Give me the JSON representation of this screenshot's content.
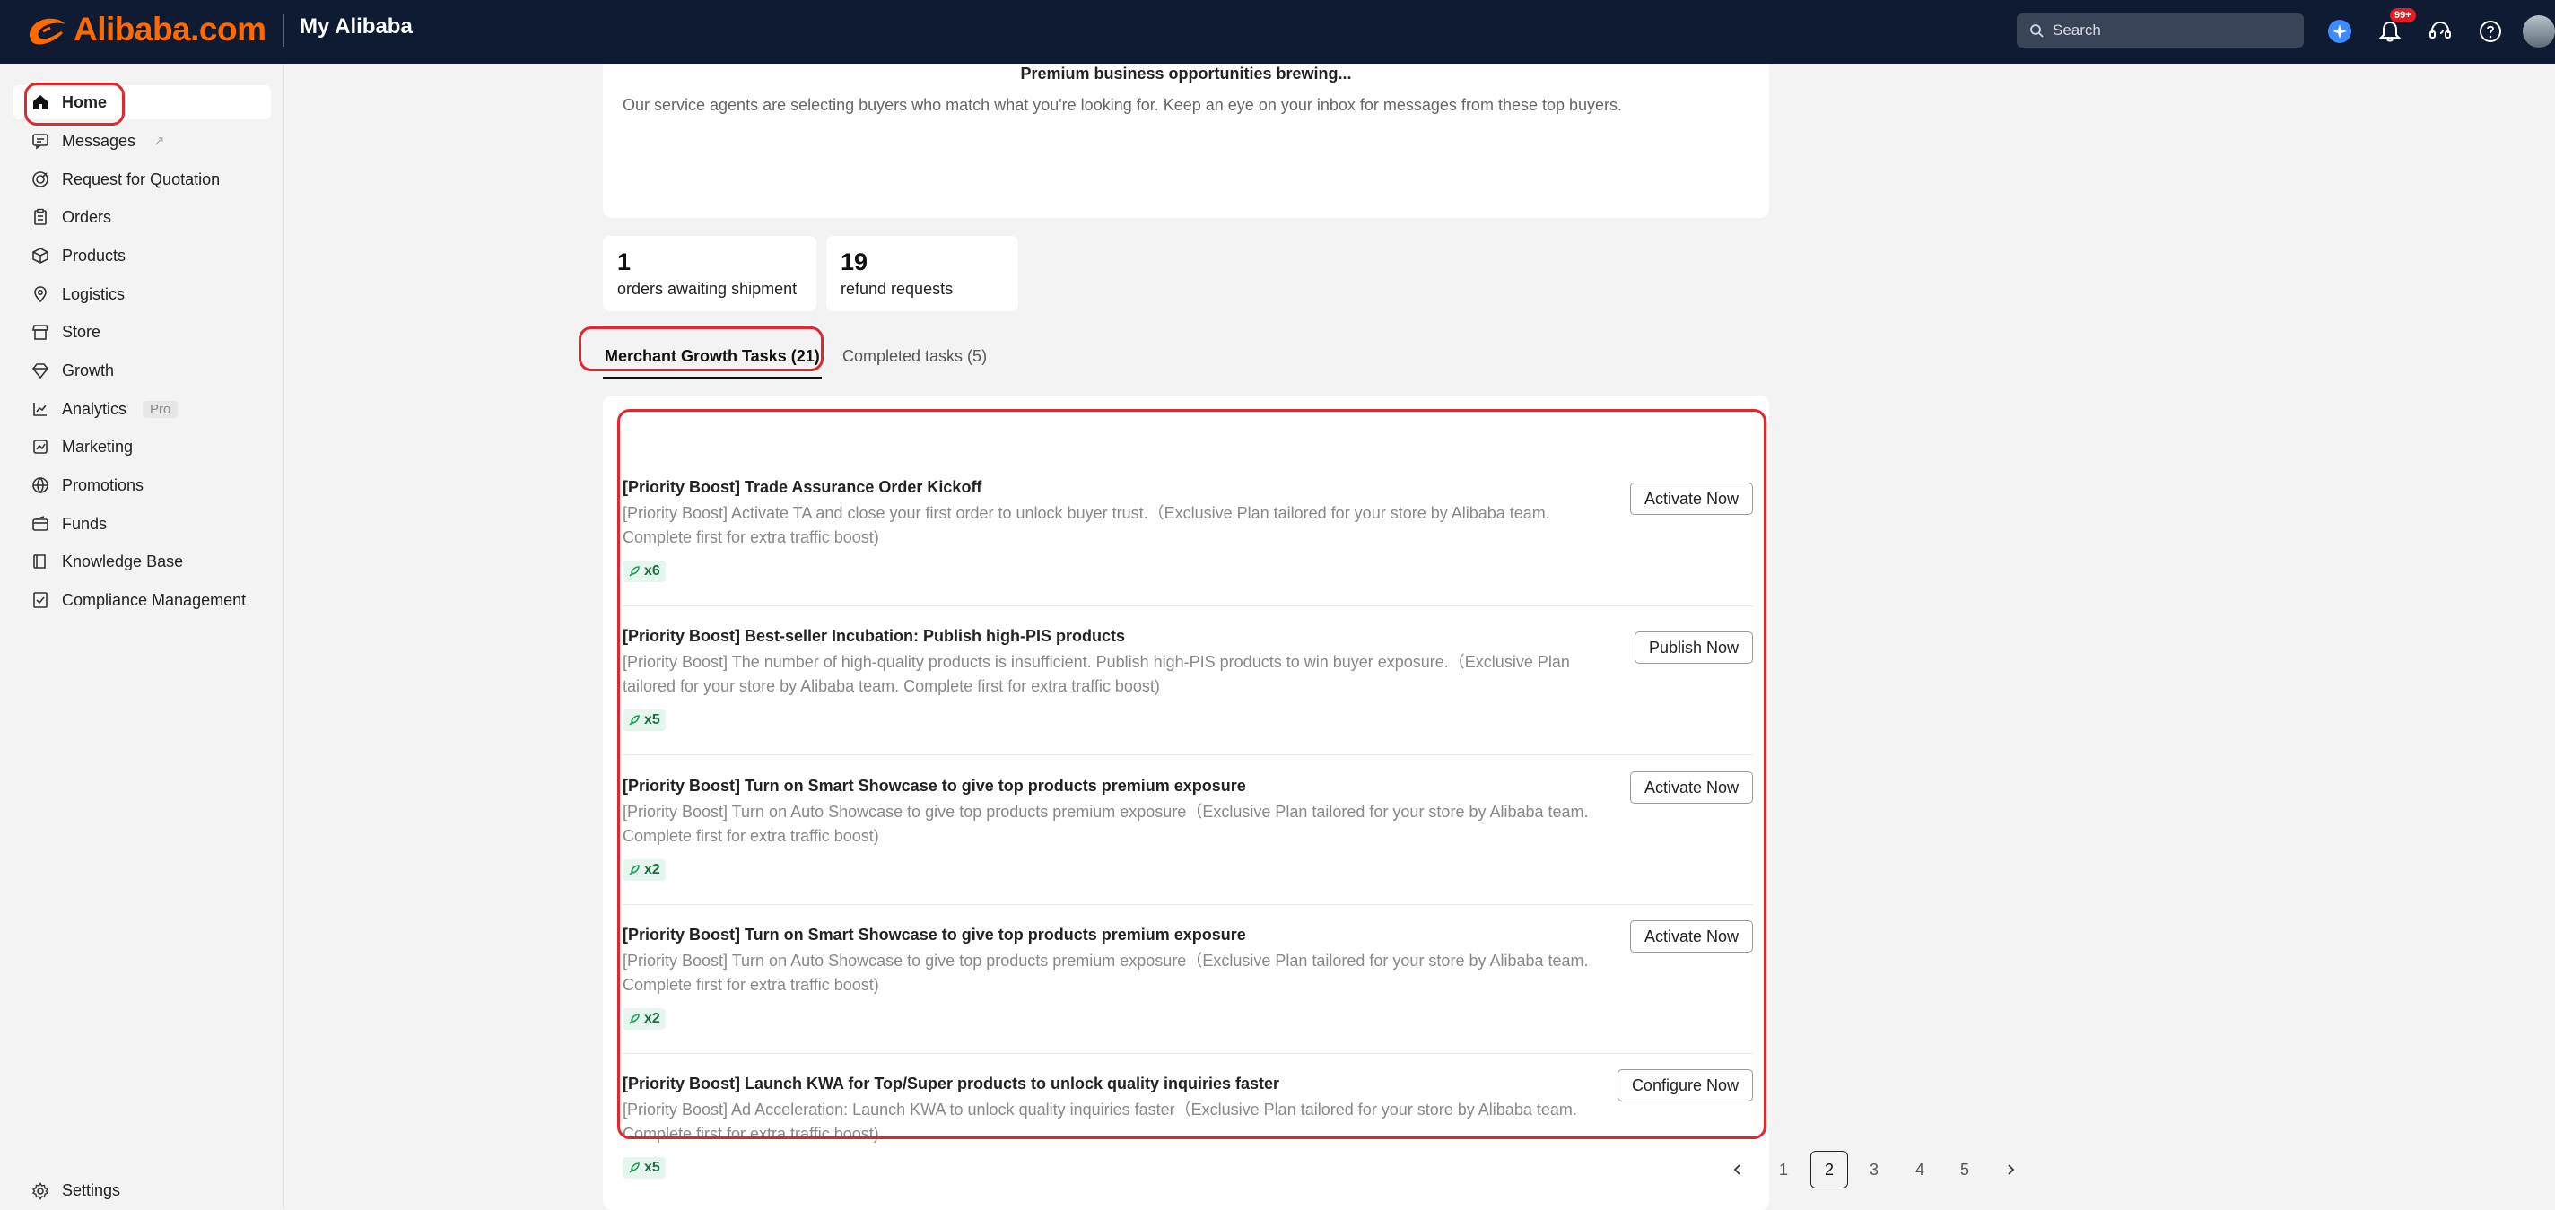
{
  "header": {
    "brand": "Alibaba.com",
    "title": "My Alibaba",
    "search_placeholder": "Search",
    "notification_badge": "99+",
    "brand_color": "#ff6a00"
  },
  "sidebar": {
    "items": [
      {
        "label": "Home",
        "icon": "home-icon",
        "active": true
      },
      {
        "label": "Messages",
        "icon": "message-icon"
      },
      {
        "label": "Request for Quotation",
        "icon": "quotation-icon"
      },
      {
        "label": "Orders",
        "icon": "orders-icon"
      },
      {
        "label": "Products",
        "icon": "box-icon"
      },
      {
        "label": "Logistics",
        "icon": "logistics-icon"
      },
      {
        "label": "Store",
        "icon": "store-icon"
      },
      {
        "label": "Growth",
        "icon": "growth-icon"
      },
      {
        "label": "Analytics",
        "icon": "analytics-icon",
        "tag": "Pro"
      },
      {
        "label": "Marketing",
        "icon": "marketing-icon"
      },
      {
        "label": "Promotions",
        "icon": "promotions-icon"
      },
      {
        "label": "Funds",
        "icon": "funds-icon"
      },
      {
        "label": "Knowledge Base",
        "icon": "book-icon"
      },
      {
        "label": "Compliance Management",
        "icon": "compliance-icon"
      }
    ],
    "settings_label": "Settings"
  },
  "banner": {
    "headline": "Premium business opportunities brewing...",
    "description": "Our service agents are selecting buyers who match what you're looking for. Keep an eye on your inbox for messages from these top buyers."
  },
  "stats": [
    {
      "value": "1",
      "label": "orders awaiting shipment"
    },
    {
      "value": "19",
      "label": "refund requests"
    }
  ],
  "tabs": [
    {
      "label": "Merchant Growth Tasks (21)",
      "active": true
    },
    {
      "label": "Completed tasks (5)",
      "active": false
    }
  ],
  "tasks": [
    {
      "title": "[Priority Boost] Trade Assurance Order Kickoff",
      "description": "[Priority Boost] Activate TA and close your first order to unlock buyer trust.（Exclusive Plan tailored for your store by Alibaba team. Complete first for extra traffic boost)",
      "multiplier": "x6",
      "action": "Activate Now"
    },
    {
      "title": "[Priority Boost] Best-seller Incubation: Publish high-PIS products",
      "description": "[Priority Boost] The number of high-quality products is insufficient. Publish high-PIS products to win buyer exposure.（Exclusive Plan tailored for your store by Alibaba team. Complete first for extra traffic boost)",
      "multiplier": "x5",
      "action": "Publish Now"
    },
    {
      "title": "[Priority Boost] Turn on Smart Showcase to give top products premium exposure",
      "description": "[Priority Boost] Turn on Auto Showcase to give top products premium exposure（Exclusive Plan tailored for your store by Alibaba team. Complete first for extra traffic boost)",
      "multiplier": "x2",
      "action": "Activate Now"
    },
    {
      "title": "[Priority Boost] Turn on Smart Showcase to give top products premium exposure",
      "description": "[Priority Boost] Turn on Auto Showcase to give top products premium exposure（Exclusive Plan tailored for your store by Alibaba team. Complete first for extra traffic boost)",
      "multiplier": "x2",
      "action": "Activate Now"
    },
    {
      "title": "[Priority Boost] Launch KWA for Top/Super products to unlock quality inquiries faster",
      "description": "[Priority Boost] Ad Acceleration: Launch KWA to unlock quality inquiries faster（Exclusive Plan tailored for your store by Alibaba team. Complete first for extra traffic boost)",
      "multiplier": "x5",
      "action": "Configure Now"
    }
  ],
  "pagination": {
    "pages": [
      "1",
      "2",
      "3",
      "4",
      "5"
    ],
    "current": "2"
  },
  "highlight_color": "#e3262d"
}
